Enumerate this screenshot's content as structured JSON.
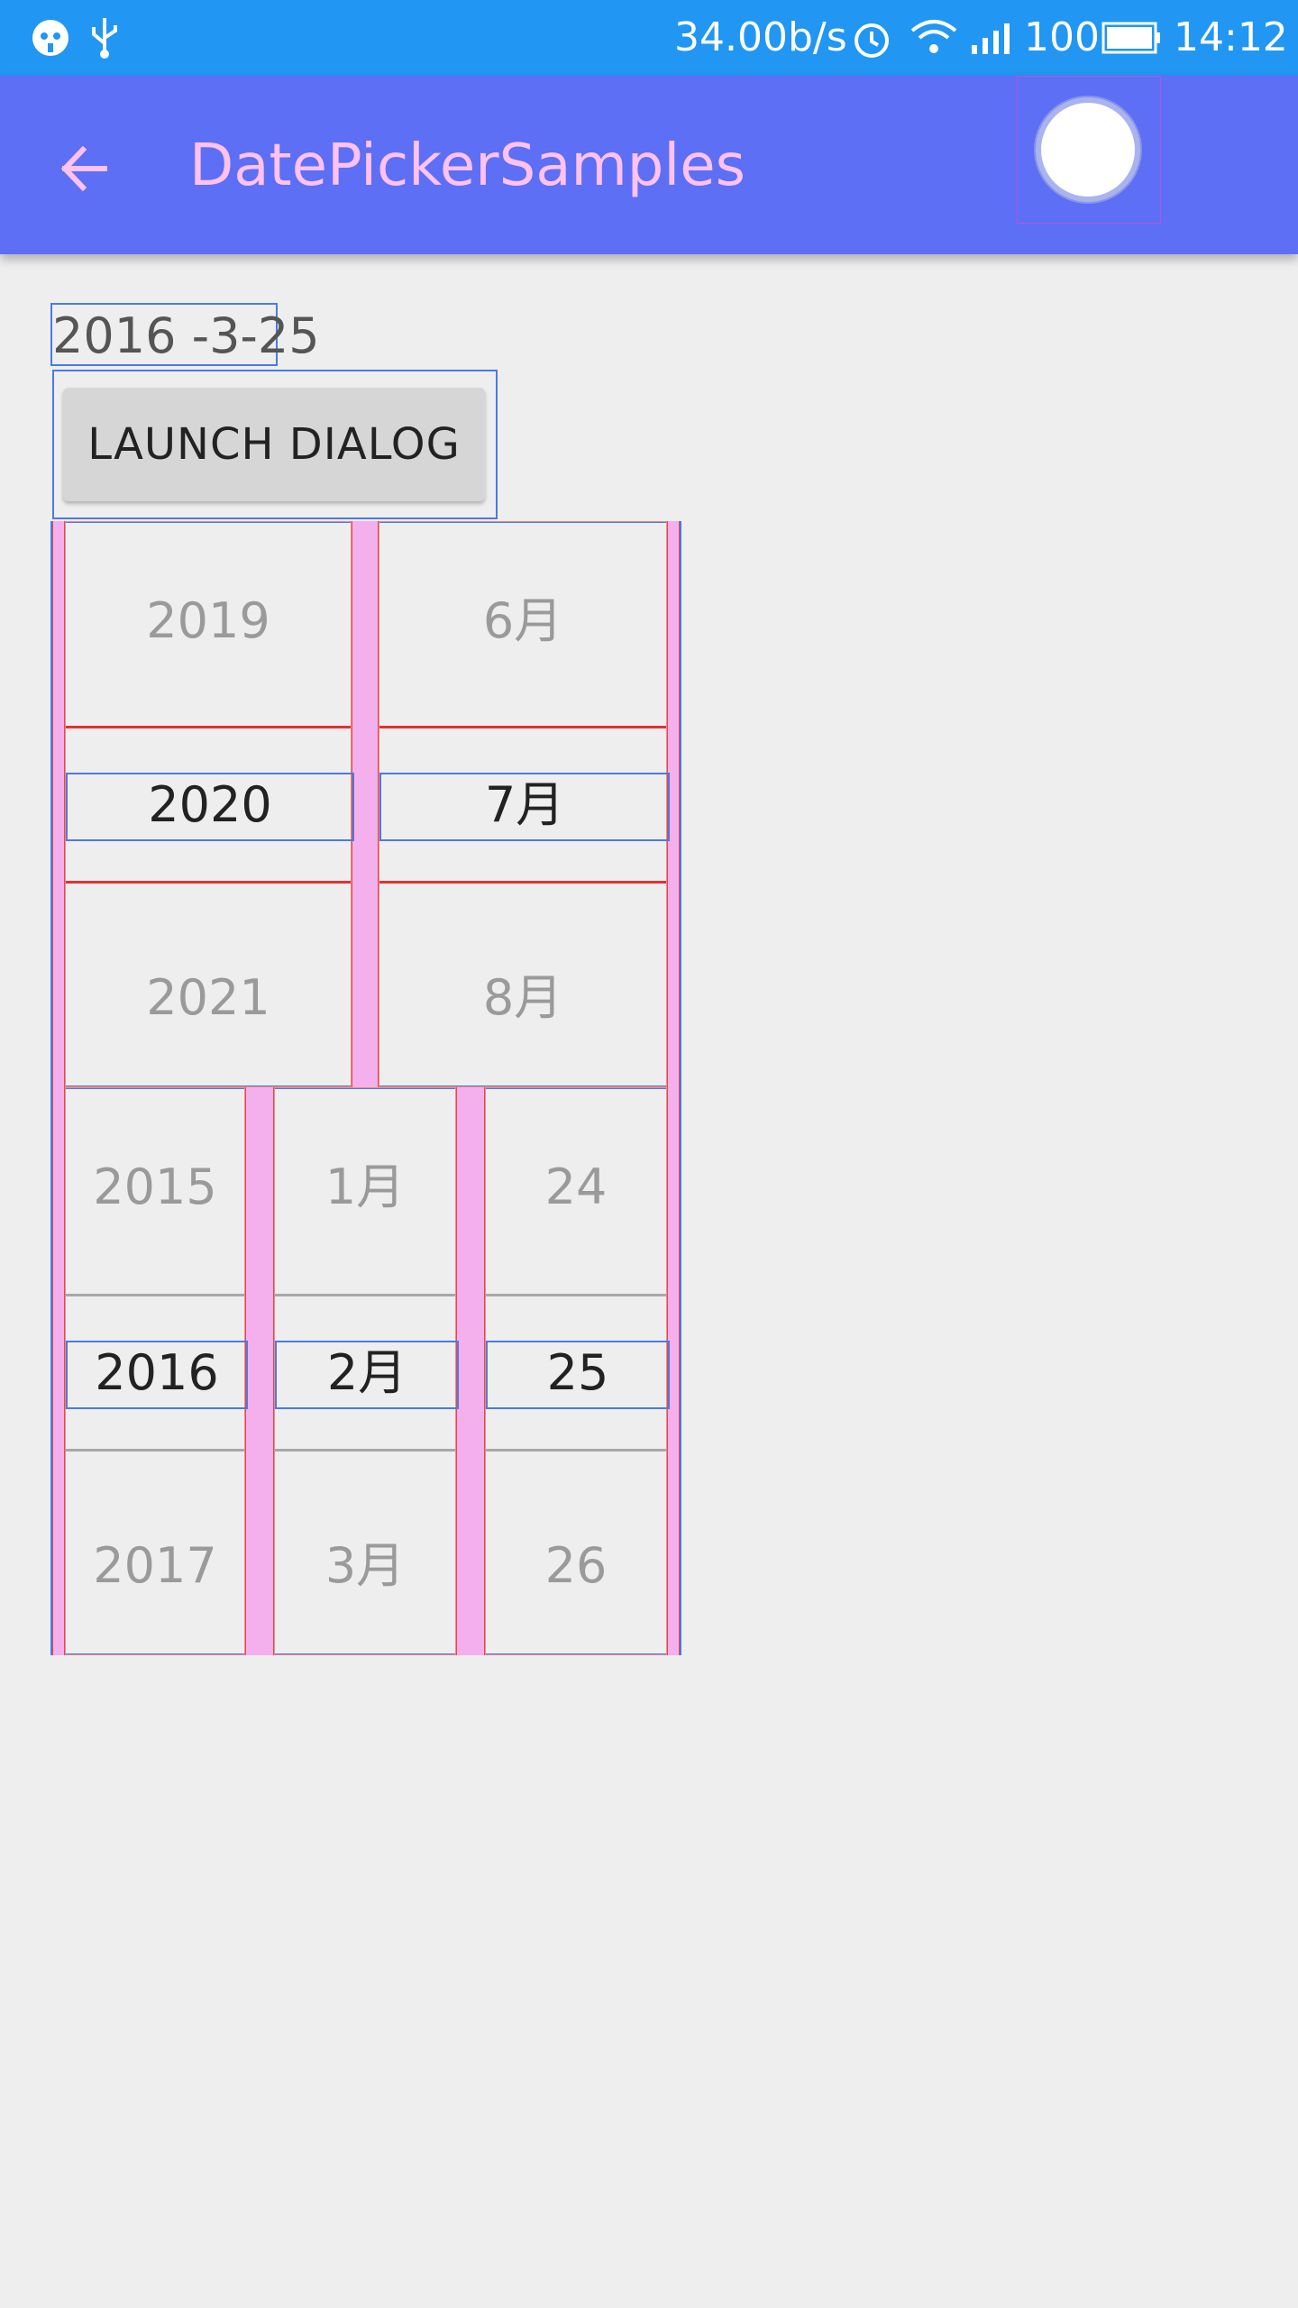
{
  "status_bar": {
    "network_speed": "34.00b/s",
    "battery": "100",
    "time": "14:12"
  },
  "toolbar": {
    "title": "DatePickerSamples"
  },
  "date_display": "2016 -3-25",
  "launch_button_label": "LAUNCH DIALOG",
  "picker_top": {
    "year": {
      "prev": "2019",
      "current": "2020",
      "next": "2021"
    },
    "month": {
      "prev": "6月",
      "current": "7月",
      "next": "8月"
    }
  },
  "picker_bottom": {
    "year": {
      "prev": "2015",
      "current": "2016",
      "next": "2017"
    },
    "month": {
      "prev": "1月",
      "current": "2月",
      "next": "3月"
    },
    "day": {
      "prev": "24",
      "current": "25",
      "next": "26"
    }
  },
  "colors": {
    "status_bar": "#2196f3",
    "toolbar": "#5c6ff5",
    "title_text": "#ffc1ee",
    "background": "#eeeeee"
  }
}
